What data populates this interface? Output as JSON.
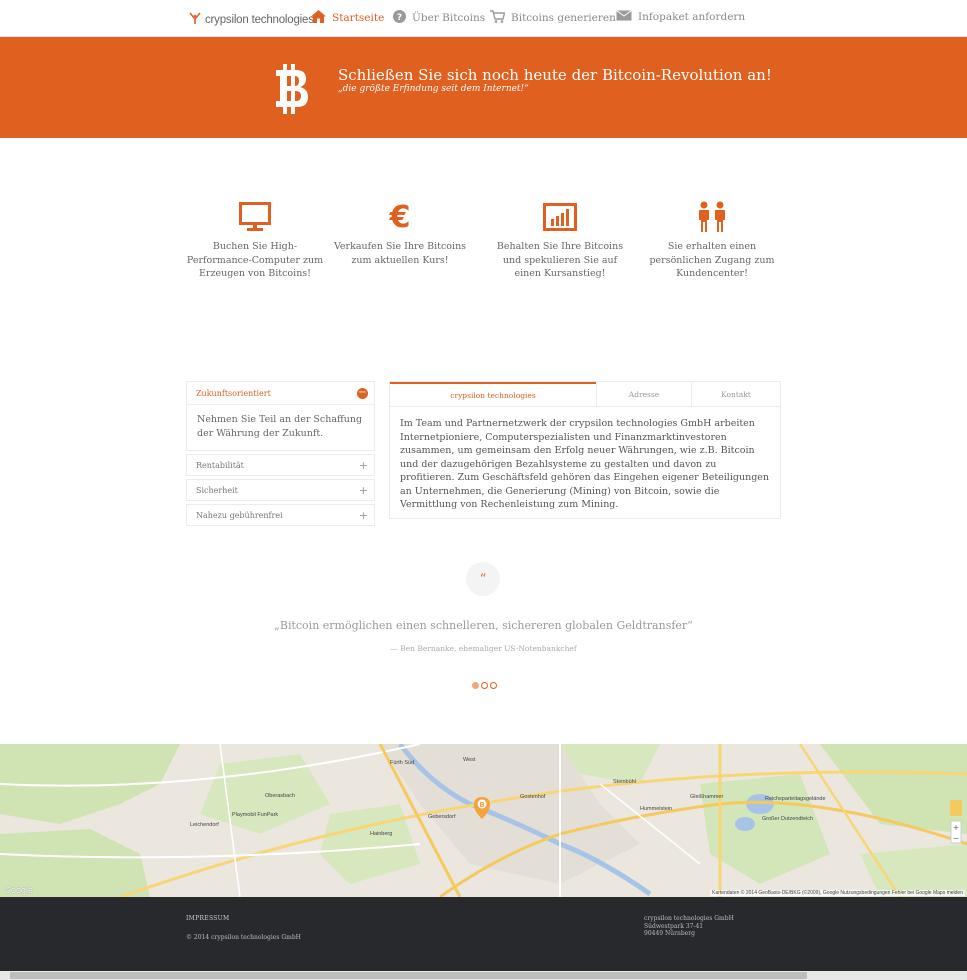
{
  "colors": {
    "accent": "#e0601f",
    "footer": "#27292d"
  },
  "nav": {
    "logo_text": "crypsilon technologies",
    "items": [
      {
        "label": "Startseite",
        "icon": "home-icon",
        "active": true
      },
      {
        "label": "Über Bitcoins",
        "icon": "question-icon",
        "active": false
      },
      {
        "label": "Bitcoins generieren",
        "icon": "cart-icon",
        "active": false
      },
      {
        "label": "Infopaket anfordern",
        "icon": "mail-icon",
        "active": false
      }
    ]
  },
  "hero": {
    "icon": "bitcoin-icon",
    "title": "Schließen Sie sich noch heute der Bitcoin-Revolution an!",
    "subtitle": "„die größte Erfindung seit dem Internet!“"
  },
  "features": [
    {
      "icon": "monitor-icon",
      "text": "Buchen Sie High-Performance-Computer zum Erzeugen von Bitcoins!"
    },
    {
      "icon": "euro-icon",
      "text": "Verkaufen Sie Ihre Bitcoins zum aktuellen Kurs!"
    },
    {
      "icon": "chart-icon",
      "text": "Behalten Sie Ihre Bitcoins und spekulieren Sie auf einen Kursanstieg!"
    },
    {
      "icon": "people-icon",
      "text": "Sie erhalten einen persönlichen Zugang zum Kundencenter!"
    }
  ],
  "accordion": {
    "items": [
      {
        "label": "Zukunftsorientiert",
        "open": true,
        "body": "Nehmen Sie Teil an der Schaffung der Währung der Zukunft."
      },
      {
        "label": "Rentabilität",
        "open": false
      },
      {
        "label": "Sicherheit",
        "open": false
      },
      {
        "label": "Nahezu gebührenfrei",
        "open": false
      }
    ]
  },
  "tabs": {
    "items": [
      "crypsilon technologies",
      "Adresse",
      "Kontakt"
    ],
    "active_index": 0,
    "content": "Im Team und Partnernetzwerk der crypsilon technologies GmbH arbeiten Internetpioniere, Computerspezialisten und Finanzmarktinvestoren zusammen, um gemeinsam den Erfolg neuer Währungen, wie z.B. Bitcoin und der dazugehörigen Bezahlsysteme zu gestalten und davon zu profitieren. Zum Geschäftsfeld gehören das Eingehen eigener Beteiligungen an Unternehmen, die Generierung (Mining) von Bitcoin, sowie die Vermittlung von Rechenleistung zum Mining."
  },
  "testimonial": {
    "quote_glyph": "“",
    "quote": "„Bitcoin ermöglichen einen schnelleren, sichereren globalen Geldtransfer“",
    "author": "— Ben Bernanke, ehemaliger US-Notenbankchef",
    "slides": 3,
    "active_slide": 0
  },
  "map": {
    "attribution": "Kartendaten © 2014 GeoBasis-DE/BKG (©2009), Google   Nutzungsbedingungen   Fehler bei Google Maps melden",
    "google_label": "Google",
    "labels": [
      "Fürth Süd",
      "West",
      "Oberasbach",
      "Playmobil FunPark",
      "Steinbühl",
      "Hainberg",
      "Gebersdorf",
      "Gostenhof",
      "Hummelstein",
      "Gleißhammer",
      "Leichendorf",
      "Reichsparteitagsgelände",
      "Großer Dutzendteich"
    ]
  },
  "footer": {
    "link": "IMPRESSUM",
    "copyright": "© 2014 crypsilon technologies GmbH",
    "address": [
      "crypsilon technologies GmbH",
      "Südwestpark 37-41",
      "90449 Nürnberg"
    ]
  }
}
